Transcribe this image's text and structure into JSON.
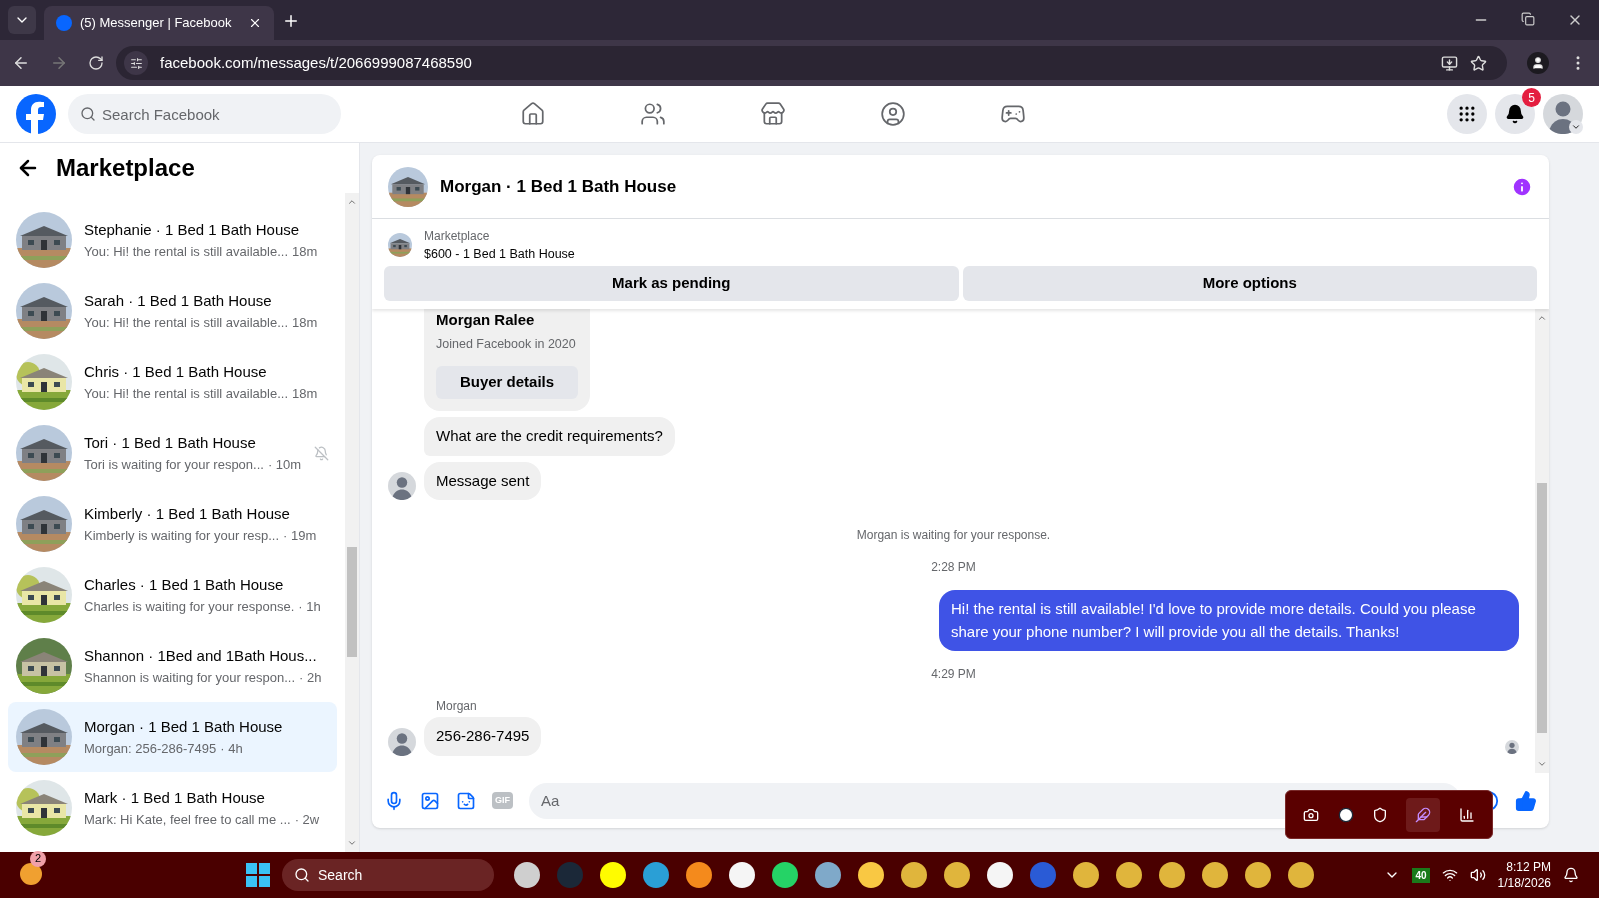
{
  "browser": {
    "tab_title": "(5) Messenger | Facebook",
    "url": "facebook.com/messages/t/2066999087468590"
  },
  "facebook_header": {
    "search_placeholder": "Search Facebook",
    "notification_count": "5"
  },
  "sidebar": {
    "title": "Marketplace",
    "conversations": [
      {
        "name": "Stephanie · 1 Bed 1 Bath House",
        "preview": "You: Hi! the rental is still available...",
        "time": "18m",
        "muted": false,
        "selected": false
      },
      {
        "name": "Sarah · 1 Bed 1 Bath House",
        "preview": "You: Hi! the rental is still available...",
        "time": "18m",
        "muted": false,
        "selected": false
      },
      {
        "name": "Chris · 1 Bed 1 Bath House",
        "preview": "You: Hi! the rental is still available...",
        "time": "18m",
        "muted": false,
        "selected": false
      },
      {
        "name": "Tori · 1 Bed 1 Bath House",
        "preview": "Tori is waiting for your respon...",
        "time": "· 10m",
        "muted": true,
        "selected": false
      },
      {
        "name": "Kimberly · 1 Bed 1 Bath House",
        "preview": "Kimberly is waiting for your resp...",
        "time": "· 19m",
        "muted": false,
        "selected": false
      },
      {
        "name": "Charles · 1 Bed 1 Bath House",
        "preview": "Charles is waiting for your response.",
        "time": "· 1h",
        "muted": false,
        "selected": false
      },
      {
        "name": "Shannon · 1Bed and 1Bath Hous...",
        "preview": "Shannon is waiting for your respon...",
        "time": "· 2h",
        "muted": false,
        "selected": false
      },
      {
        "name": "Morgan · 1 Bed 1 Bath House",
        "preview": "Morgan: 256-286-7495",
        "time": "· 4h",
        "muted": false,
        "selected": true
      },
      {
        "name": "Mark · 1 Bed 1 Bath House",
        "preview": "Mark: Hi Kate, feel free to call me ...",
        "time": "· 2w",
        "muted": false,
        "selected": false
      }
    ]
  },
  "chat": {
    "title": "Morgan · 1 Bed 1 Bath House",
    "listing": {
      "source": "Marketplace",
      "title": "$600 - 1 Bed 1 Bath House"
    },
    "actions": [
      "Mark as pending",
      "More options"
    ],
    "messages": [
      {
        "kind": "profile",
        "name": "Morgan Ralee",
        "detail": "Joined Facebook in 2020",
        "button": "Buyer details"
      },
      {
        "kind": "incoming",
        "text": "What are the credit requirements?",
        "avatar": false
      },
      {
        "kind": "incoming",
        "text": "Message sent",
        "avatar": true
      },
      {
        "kind": "notice",
        "text": "Morgan is waiting for your response."
      },
      {
        "kind": "timestamp",
        "text": "2:28 PM"
      },
      {
        "kind": "outgoing",
        "text": "Hi! the rental is still available! I'd love to provide more details. Could you please share your phone number? I will provide you all the details. Thanks!"
      },
      {
        "kind": "timestamp",
        "text": "4:29 PM"
      },
      {
        "kind": "sender",
        "text": "Morgan"
      },
      {
        "kind": "incoming",
        "text": "256-286-7495",
        "avatar": true
      }
    ],
    "composer": {
      "placeholder": "Aa",
      "gif_label": "GIF"
    }
  },
  "taskbar": {
    "widget_badge": "2",
    "search_label": "Search",
    "tray_indicator": "40",
    "time": "8:12 PM",
    "date": "1/18/2026"
  }
}
